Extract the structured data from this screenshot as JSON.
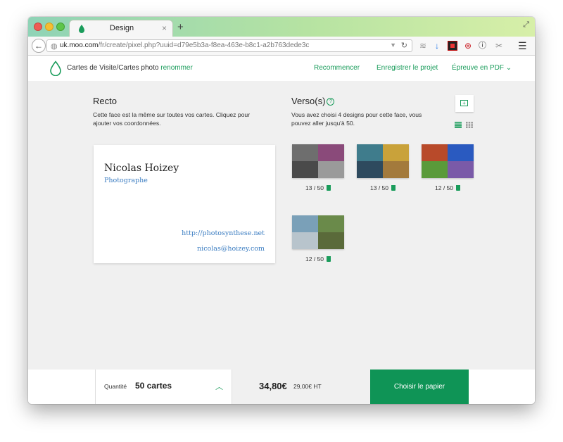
{
  "browser": {
    "tab_title": "Design",
    "tab_close": "×",
    "new_tab": "+",
    "url_domain": "uk.moo.com",
    "url_path": "/fr/create/pixel.php?uuid=d79e5b3a-f8ea-463e-b8c1-a2b763dede3c",
    "icons": [
      "back-icon",
      "globe-icon",
      "reload-icon",
      "rss-icon",
      "download-icon",
      "red-extension-icon",
      "pinterest-icon",
      "info-icon",
      "tools-icon",
      "menu-icon"
    ]
  },
  "header": {
    "brand_text": "Cartes de Visite/",
    "brand_bold": "Cartes photo",
    "rename": "renommer",
    "nav": [
      "Recommencer",
      "Enregistrer le projet",
      "Épreuve en PDF"
    ],
    "accent_color": "#1a9c5b"
  },
  "recto": {
    "title": "Recto",
    "description_line1": "Cette face est la même sur toutes vos cartes. Cliquez pour",
    "description_line2": "ajouter vos coordonnées.",
    "card": {
      "name": "Nicolas Hoizey",
      "role": "Photographe",
      "url": "http://photosynthese.net",
      "email": "nicolas@hoizey.com"
    }
  },
  "verso": {
    "title": "Verso(s)",
    "help": "?",
    "description_line1": "Vous avez choisi 4 designs pour cette face, vous",
    "description_line2": "pouvez aller jusqu'à 50.",
    "designs": [
      {
        "count": "13 / 50",
        "colors": [
          "#6e6e6e",
          "#8a4a7a",
          "#4a4a4a",
          "#9a9a9a"
        ]
      },
      {
        "count": "13 / 50",
        "colors": [
          "#3f7c8c",
          "#c9a23a",
          "#2e4a5e",
          "#a37a3c"
        ]
      },
      {
        "count": "12 / 50",
        "colors": [
          "#b84a2a",
          "#2a5ac0",
          "#5a9a3a",
          "#7a5aa8"
        ]
      },
      {
        "count": "12 / 50",
        "colors": [
          "#7aa0b8",
          "#6a8a4a",
          "#b8c4cc",
          "#5a6a3a"
        ]
      }
    ]
  },
  "bottom": {
    "quantity_label": "Quantité",
    "quantity_value": "50 cartes",
    "chevron": "︿",
    "price": "34,80€",
    "price_ht": "29,00€ HT",
    "cta": "Choisir le papier",
    "cta_color": "#0f9456"
  }
}
